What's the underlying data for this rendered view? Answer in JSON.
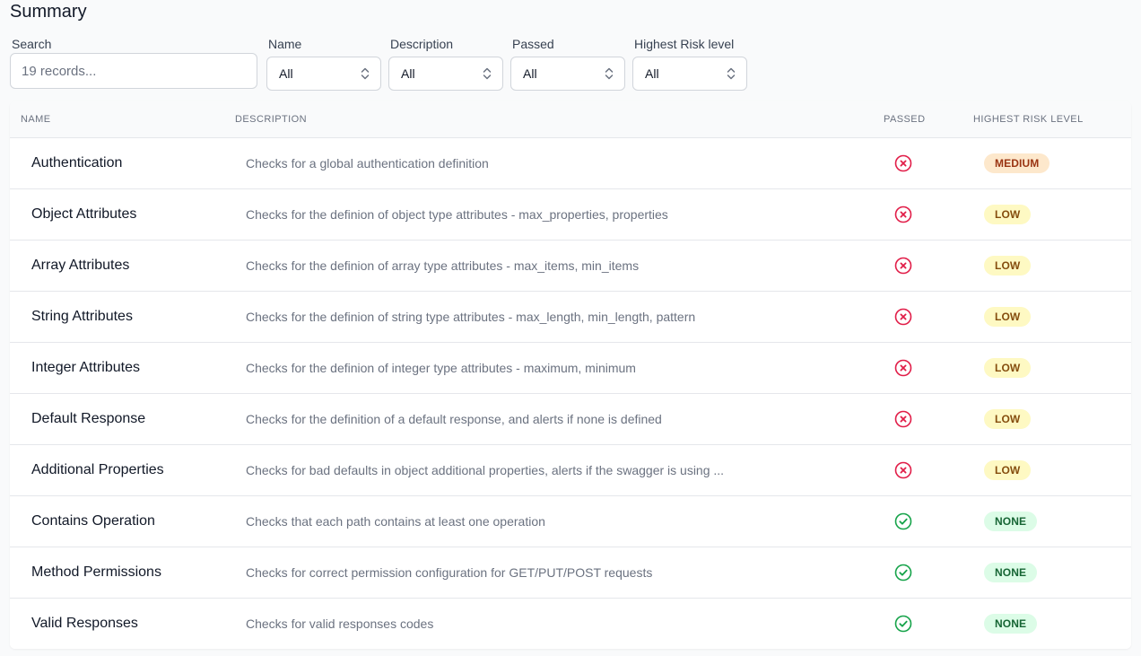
{
  "page": {
    "title": "Summary"
  },
  "filters": {
    "search": {
      "label": "Search",
      "placeholder": "19 records...",
      "value": ""
    },
    "name": {
      "label": "Name",
      "value": "All"
    },
    "description": {
      "label": "Description",
      "value": "All"
    },
    "passed": {
      "label": "Passed",
      "value": "All"
    },
    "risk": {
      "label": "Highest Risk level",
      "value": "All"
    }
  },
  "table": {
    "headers": {
      "name": "NAME",
      "description": "DESCRIPTION",
      "passed": "PASSED",
      "risk": "HIGHEST RISK LEVEL"
    },
    "rows": [
      {
        "name": "Authentication",
        "description": "Checks for a global authentication definition",
        "passed": false,
        "risk": "MEDIUM"
      },
      {
        "name": "Object Attributes",
        "description": "Checks for the definion of object type attributes - max_properties, properties",
        "passed": false,
        "risk": "LOW"
      },
      {
        "name": "Array Attributes",
        "description": "Checks for the definion of array type attributes - max_items, min_items",
        "passed": false,
        "risk": "LOW"
      },
      {
        "name": "String Attributes",
        "description": "Checks for the definion of string type attributes - max_length, min_length, pattern",
        "passed": false,
        "risk": "LOW"
      },
      {
        "name": "Integer Attributes",
        "description": "Checks for the definion of integer type attributes - maximum, minimum",
        "passed": false,
        "risk": "LOW"
      },
      {
        "name": "Default Response",
        "description": "Checks for the definition of a default response, and alerts if none is defined",
        "passed": false,
        "risk": "LOW"
      },
      {
        "name": "Additional Properties",
        "description": "Checks for bad defaults in object additional properties, alerts if the swagger is using ...",
        "passed": false,
        "risk": "LOW"
      },
      {
        "name": "Contains Operation",
        "description": "Checks that each path contains at least one operation",
        "passed": true,
        "risk": "NONE"
      },
      {
        "name": "Method Permissions",
        "description": "Checks for correct permission configuration for GET/PUT/POST requests",
        "passed": true,
        "risk": "NONE"
      },
      {
        "name": "Valid Responses",
        "description": "Checks for valid responses codes",
        "passed": true,
        "risk": "NONE"
      }
    ]
  },
  "icons": {
    "fail": "x-circle-icon",
    "pass": "check-circle-icon",
    "select": "chevron-up-down-icon"
  },
  "colors": {
    "fail": "#e11d48",
    "pass": "#16a34a",
    "badge_medium_bg": "#fde8cc",
    "badge_medium_fg": "#9a3412",
    "badge_low_bg": "#fef9c3",
    "badge_low_fg": "#854d0e",
    "badge_none_bg": "#dcfce7",
    "badge_none_fg": "#166534"
  }
}
